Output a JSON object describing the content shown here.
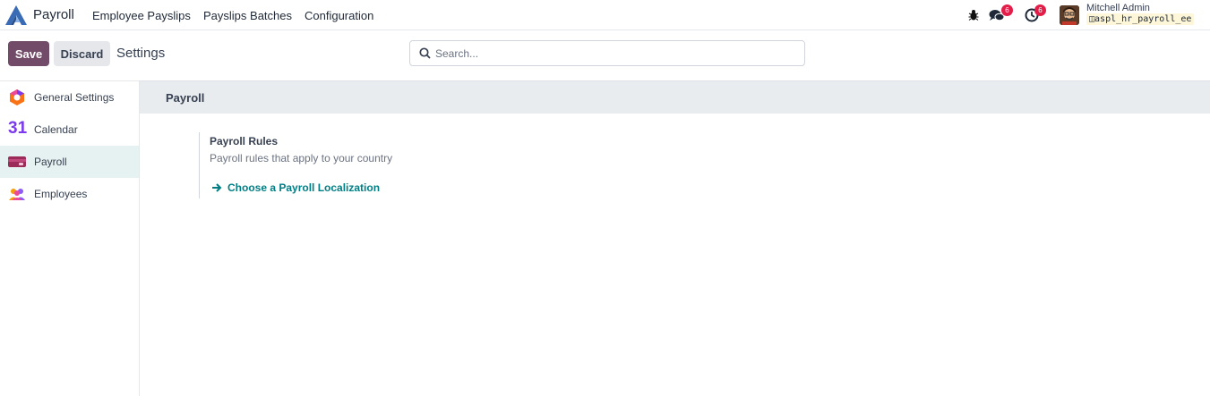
{
  "navbar": {
    "app_name": "Payroll",
    "menu": [
      "Employee Payslips",
      "Payslips Batches",
      "Configuration"
    ],
    "messages_count": "6",
    "activities_count": "6",
    "user_name": "Mitchell Admin",
    "database": "aspl_hr_payroll_ee"
  },
  "control_panel": {
    "save_label": "Save",
    "discard_label": "Discard",
    "title": "Settings",
    "search_placeholder": "Search..."
  },
  "sidebar": {
    "items": [
      {
        "label": "General Settings",
        "icon": "general-settings-icon"
      },
      {
        "label": "Calendar",
        "icon": "calendar-icon"
      },
      {
        "label": "Payroll",
        "icon": "payroll-icon",
        "active": true
      },
      {
        "label": "Employees",
        "icon": "employees-icon"
      }
    ],
    "calendar_glyph": "31"
  },
  "main": {
    "section_title": "Payroll",
    "setting": {
      "title": "Payroll Rules",
      "description": "Payroll rules that apply to your country",
      "link_label": "Choose a Payroll Localization"
    }
  },
  "colors": {
    "brand": "#714b67",
    "link": "#017e84",
    "badge": "#e11d48",
    "active_bg": "#e6f2f2"
  }
}
